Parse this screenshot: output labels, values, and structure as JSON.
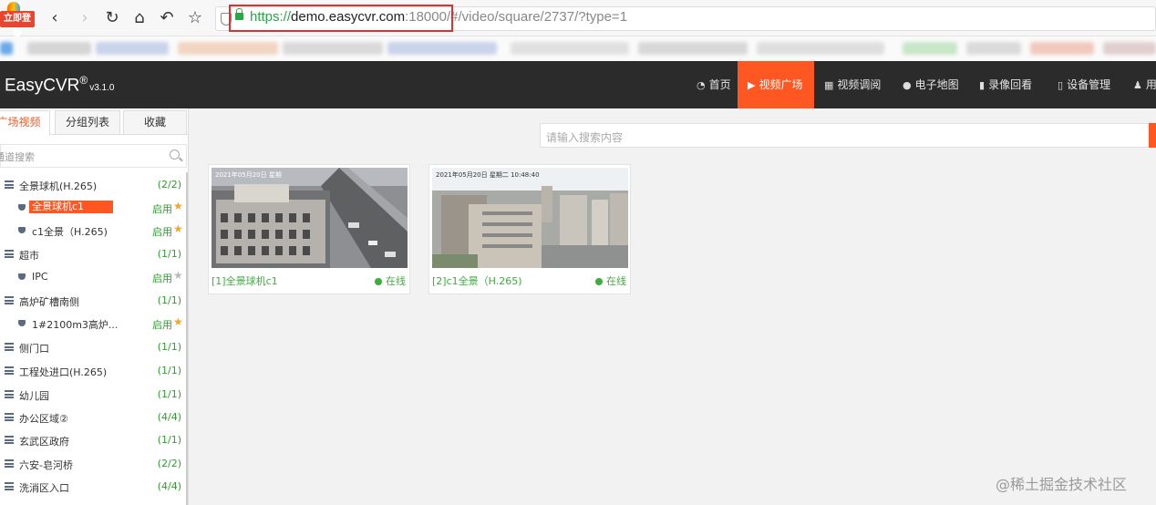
{
  "browser": {
    "login_badge": "立即登录",
    "url": {
      "protocol": "https://",
      "host": "demo.easycvr.com",
      "port": ":18000",
      "path": "/#/video/square/2737/?type=1"
    }
  },
  "app": {
    "logo": "EasyCVR",
    "logo_mark": "®",
    "version": "v3.1.0",
    "nav": [
      {
        "label": "首页",
        "icon": "dashboard-icon"
      },
      {
        "label": "视频广场",
        "icon": "play-circle-icon",
        "active": true
      },
      {
        "label": "视频调阅",
        "icon": "grid-icon"
      },
      {
        "label": "电子地图",
        "icon": "map-pin-icon"
      },
      {
        "label": "录像回看",
        "icon": "video-camera-icon"
      },
      {
        "label": "设备管理",
        "icon": "device-icon"
      },
      {
        "label": "用",
        "icon": "user-icon"
      }
    ],
    "accent_color": "#ff5722"
  },
  "sidebar": {
    "tabs": [
      "广场视频",
      "分组列表",
      "收藏"
    ],
    "search_placeholder": "通道搜索",
    "tree": [
      {
        "type": "group",
        "name": "全景球机(H.265)",
        "count": "(2/2)"
      },
      {
        "type": "channel",
        "name": "全景球机c1",
        "status": "启用",
        "starred": true,
        "selected": true
      },
      {
        "type": "channel",
        "name": "c1全景（H.265)",
        "status": "启用",
        "starred": true
      },
      {
        "type": "group",
        "name": "超市",
        "count": "(1/1)"
      },
      {
        "type": "channel",
        "name": "IPC",
        "status": "启用",
        "starred": false
      },
      {
        "type": "group",
        "name": "高炉矿槽南侧",
        "count": "(1/1)"
      },
      {
        "type": "channel",
        "name": "1#2100m3高炉...",
        "status": "启用",
        "starred": true
      },
      {
        "type": "group",
        "name": "侧门口",
        "count": "(1/1)"
      },
      {
        "type": "group",
        "name": "工程处进口(H.265)",
        "count": "(1/1)"
      },
      {
        "type": "group",
        "name": "幼儿园",
        "count": "(1/1)"
      },
      {
        "type": "group",
        "name": "办公区域②",
        "count": "(4/4)"
      },
      {
        "type": "group",
        "name": "玄武区政府",
        "count": "(1/1)"
      },
      {
        "type": "group",
        "name": "六安-皂河桥",
        "count": "(2/2)"
      },
      {
        "type": "group",
        "name": "洗消区入口",
        "count": "(4/4)"
      }
    ]
  },
  "main": {
    "search_placeholder": "请输入搜索内容",
    "cards": [
      {
        "title": "[1]全景球机c1",
        "status": "在线",
        "stamp": "2021年05月20日 星期"
      },
      {
        "title": "[2]c1全景（H.265)",
        "status": "在线",
        "stamp": "2021年05月20日 星期二 10:48:40"
      }
    ]
  },
  "watermark": "@稀土掘金技术社区"
}
